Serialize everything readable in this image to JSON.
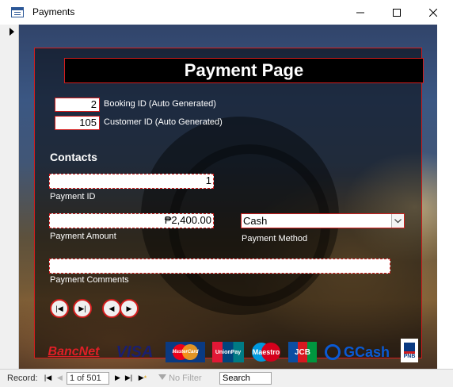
{
  "window": {
    "title": "Payments"
  },
  "form": {
    "title": "Payment Page",
    "booking_id": {
      "value": "2",
      "label": "Booking ID (Auto Generated)"
    },
    "customer_id": {
      "value": "105",
      "label": "Customer ID (Auto Generated)"
    },
    "section_contacts": "Contacts",
    "payment_id": {
      "value": "1",
      "label": "Payment ID"
    },
    "payment_amount": {
      "value": "₱2,400.00",
      "label": "Payment Amount"
    },
    "payment_method": {
      "value": "Cash",
      "label": "Payment Method"
    },
    "payment_comments": {
      "value": "",
      "label": "Payment Comments"
    },
    "nav_buttons": {
      "first": "|◀",
      "last": "▶|",
      "prev": "◀",
      "next": "▶"
    },
    "logos": [
      "BancNet",
      "VISA",
      "MasterCard",
      "UnionPay",
      "Maestro",
      "JCB",
      "GCash",
      "PNB"
    ]
  },
  "statusbar": {
    "record_label": "Record:",
    "record_position": "1 of 501",
    "filter_label": "No Filter",
    "search_label": "Search"
  },
  "colors": {
    "accent": "#d21d1d",
    "panel": "#000000"
  }
}
